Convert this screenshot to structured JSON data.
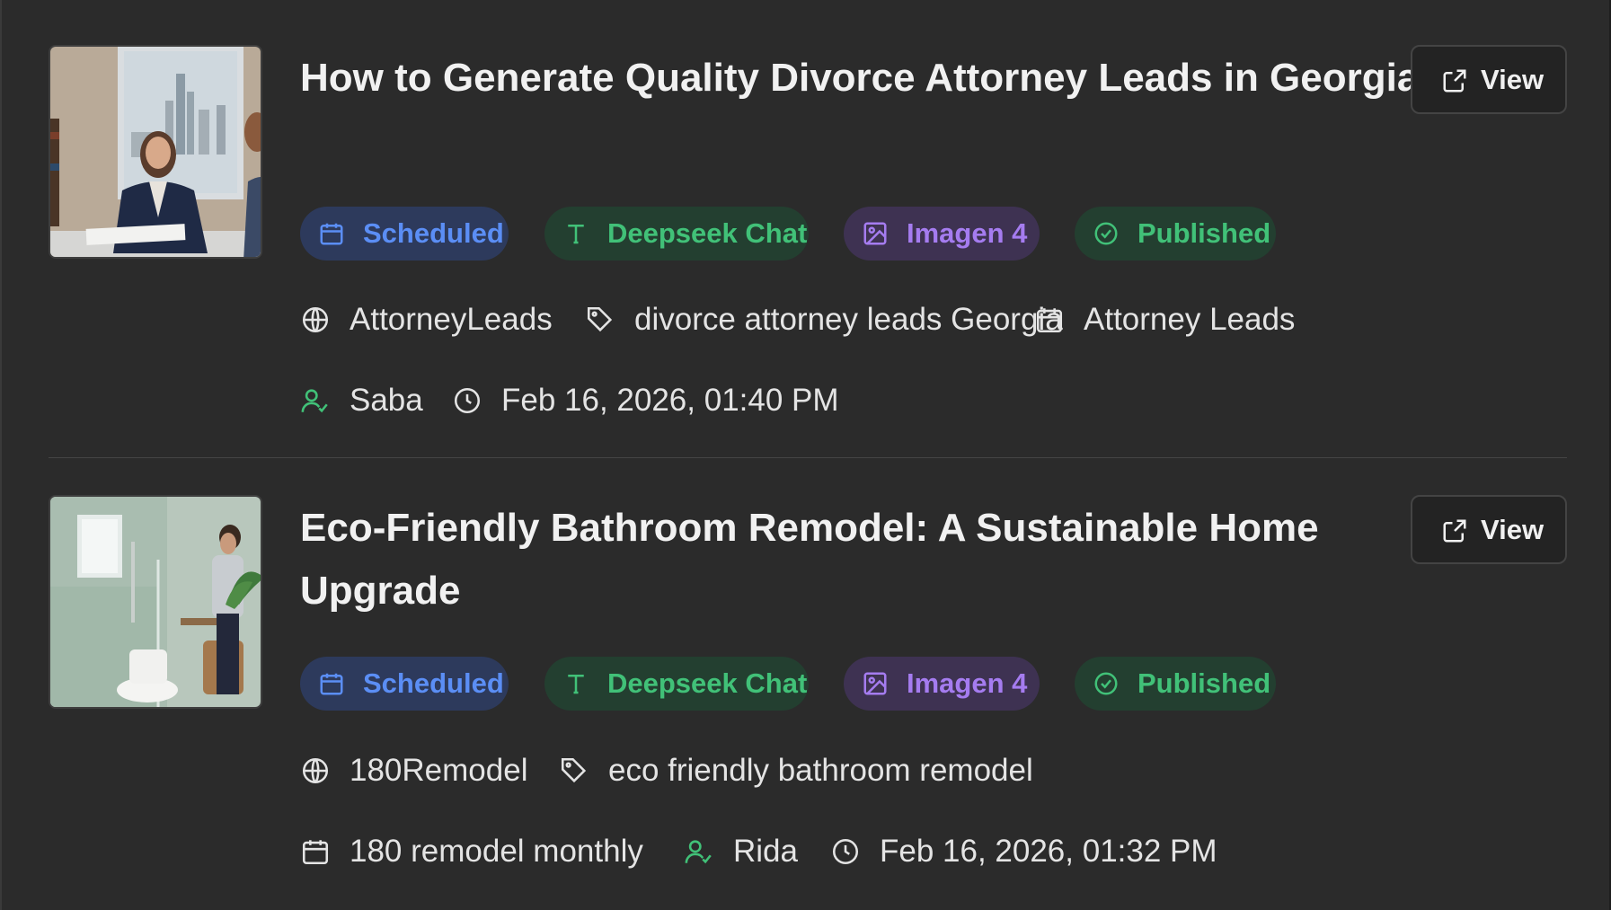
{
  "posts": [
    {
      "title": "How to Generate Quality Divorce Attorney Leads in Georgia",
      "view_label": "View",
      "badges": {
        "status": "Scheduled",
        "text_model": "Deepseek Chat",
        "image_model": "Imagen 4",
        "publish": "Published"
      },
      "site": "AttorneyLeads",
      "keyword": "divorce attorney leads Georgia",
      "campaign": "Attorney Leads",
      "author": "Saba",
      "datetime": "Feb 16, 2026, 01:40 PM"
    },
    {
      "title": "Eco-Friendly Bathroom Remodel: A Sustainable Home Upgrade",
      "view_label": "View",
      "badges": {
        "status": "Scheduled",
        "text_model": "Deepseek Chat",
        "image_model": "Imagen 4",
        "publish": "Published"
      },
      "site": "180Remodel",
      "keyword": "eco friendly bathroom remodel",
      "campaign": "180 remodel monthly",
      "author": "Rida",
      "datetime": "Feb 16, 2026, 01:32 PM"
    }
  ],
  "colors": {
    "blue": "#5b8ef5",
    "green": "#41c178",
    "purple": "#a57cf0",
    "background": "#2b2b2b"
  },
  "icons": [
    "calendar-icon",
    "text-icon",
    "image-icon",
    "check-circle-icon",
    "globe-icon",
    "tag-icon",
    "user-check-icon",
    "clock-icon",
    "external-link-icon"
  ]
}
